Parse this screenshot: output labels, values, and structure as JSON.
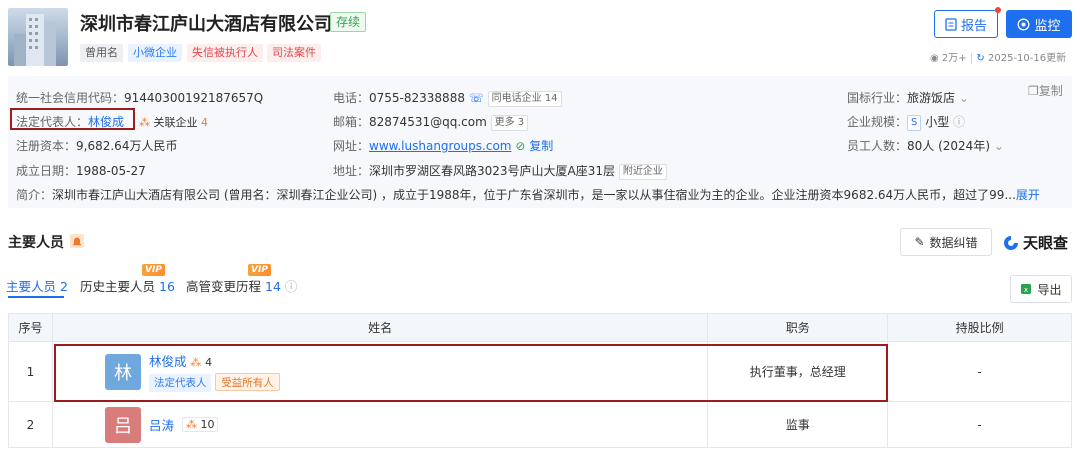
{
  "header": {
    "company_name": "深圳市春江庐山大酒店有限公司",
    "status": "存续",
    "tags": [
      "曾用名",
      "小微企业",
      "失信被执行人",
      "司法案件"
    ],
    "report_label": "报告",
    "monitor_label": "监控",
    "views": "2万+",
    "update_date": "2025-10-16更新"
  },
  "info": {
    "copy_label": "复制",
    "credit_code_label": "统一社会信用代码：",
    "credit_code": "91440300192187657Q",
    "legal_rep_label": "法定代表人：",
    "legal_rep": "林俊成",
    "related_label": "关联企业",
    "related_count": "4",
    "capital_label": "注册资本：",
    "capital": "9,682.64万人民币",
    "founded_label": "成立日期：",
    "founded": "1988-05-27",
    "phone_label": "电话：",
    "phone": "0755-82338888",
    "same_phone": "同电话企业 14",
    "email_label": "邮箱：",
    "email": "82874531@qq.com",
    "more_email": "更多 3",
    "website_label": "网址：",
    "website": "www.lushangroups.com",
    "website_copy": "复制",
    "address_label": "地址：",
    "address": "深圳市罗湖区春风路3023号庐山大厦A座31层",
    "nearby": "附近企业",
    "industry_label": "国标行业：",
    "industry": "旅游饭店",
    "scale_label": "企业规模：",
    "scale_badge": "S",
    "scale": "小型",
    "staff_label": "员工人数：",
    "staff": "80人 (2024年)",
    "intro_label": "简介：",
    "intro": "深圳市春江庐山大酒店有限公司 (曾用名：深圳春江企业公司) ，成立于1988年，位于广东省深圳市，是一家以从事住宿业为主的企业。企业注册资本9682.64万人民币，超过了99...",
    "expand": "展开"
  },
  "section": {
    "title": "主要人员",
    "correct_label": "数据纠错",
    "brand_label": "天眼查",
    "export_label": "导出",
    "tabs": [
      {
        "label": "主要人员",
        "count": "2"
      },
      {
        "label": "历史主要人员",
        "count": "16",
        "vip": "VIP"
      },
      {
        "label": "高管变更历程",
        "count": "14",
        "vip": "VIP"
      }
    ]
  },
  "table": {
    "headers": [
      "序号",
      "姓名",
      "职务",
      "持股比例"
    ],
    "rows": [
      {
        "index": "1",
        "avatar": "林",
        "name": "林俊成",
        "link_count": "4",
        "tags": [
          "法定代表人",
          "受益所有人"
        ],
        "position": "执行董事，总经理",
        "share": "-"
      },
      {
        "index": "2",
        "avatar": "吕",
        "name": "吕涛",
        "link_count": "10",
        "tags": [],
        "position": "监事",
        "share": "-"
      }
    ]
  },
  "colors": {
    "accent": "#1e6ff0",
    "status_green": "#35a451",
    "highlight_frame": "#9c1c1c",
    "avatar_1": "#6fa8dc",
    "avatar_2": "#d97c7c"
  }
}
